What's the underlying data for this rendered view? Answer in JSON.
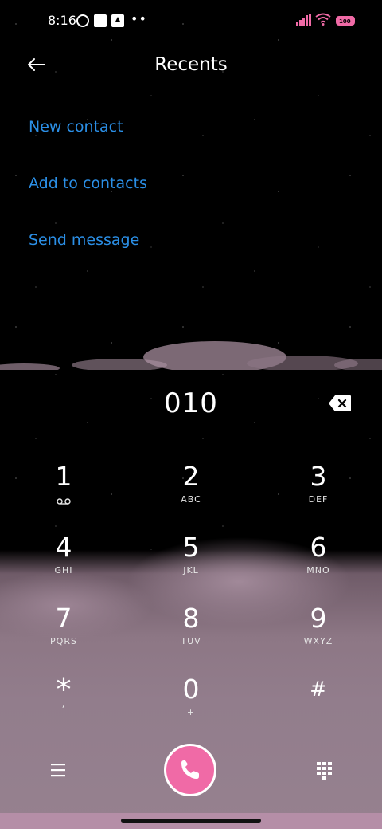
{
  "status": {
    "time": "8:16",
    "battery": "100"
  },
  "header": {
    "title": "Recents"
  },
  "actions": {
    "new_contact": "New contact",
    "add_to_contacts": "Add to contacts",
    "send_message": "Send message"
  },
  "dialer": {
    "number": "010",
    "keys": [
      {
        "digit": "1",
        "sub": ""
      },
      {
        "digit": "2",
        "sub": "ABC"
      },
      {
        "digit": "3",
        "sub": "DEF"
      },
      {
        "digit": "4",
        "sub": "GHI"
      },
      {
        "digit": "5",
        "sub": "JKL"
      },
      {
        "digit": "6",
        "sub": "MNO"
      },
      {
        "digit": "7",
        "sub": "PQRS"
      },
      {
        "digit": "8",
        "sub": "TUV"
      },
      {
        "digit": "9",
        "sub": "WXYZ"
      },
      {
        "digit": "*",
        "sub": ","
      },
      {
        "digit": "0",
        "sub": "+"
      },
      {
        "digit": "#",
        "sub": ""
      }
    ]
  },
  "icons": {
    "back": "arrow-left-icon",
    "backspace": "backspace-icon",
    "voicemail": "voicemail-icon",
    "menu": "menu-icon",
    "call": "phone-icon",
    "dialpad": "dialpad-icon"
  },
  "colors": {
    "accent_link": "#2b8fe6",
    "call_button": "#f06aa6",
    "status_pink": "#f06aa6"
  }
}
